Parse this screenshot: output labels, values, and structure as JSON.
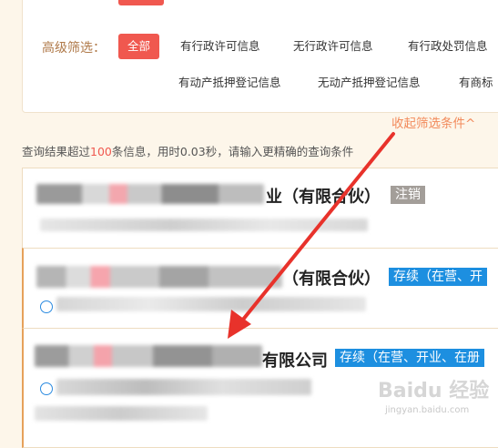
{
  "filter": {
    "label": "高级筛选：",
    "options": [
      {
        "label": "全部",
        "active": true
      },
      {
        "label": "有行政许可信息"
      },
      {
        "label": "无行政许可信息"
      },
      {
        "label": "有行政处罚信息"
      },
      {
        "label": "有动产抵押登记信息"
      },
      {
        "label": "无动产抵押登记信息"
      },
      {
        "label": "有商标"
      }
    ],
    "collapse_label": "收起筛选条件^"
  },
  "summary": {
    "prefix": "查询结果超过",
    "count": "100",
    "suffix": "条信息，用时0.03秒，请输入更精确的查询条件"
  },
  "results": [
    {
      "name_tail": "业（有限合伙）",
      "status": "注销",
      "status_color": "#a39e99"
    },
    {
      "name_tail": "（有限合伙）",
      "status": "存续（在营、开",
      "status_color": "#1d8fe0"
    },
    {
      "name_tail": "有限公司",
      "status": "存续（在营、开业、在册",
      "status_color": "#1d8fe0"
    }
  ],
  "watermark": {
    "logo": "Baidu 经验",
    "url": "jingyan.baidu.com"
  },
  "colors": {
    "accent": "#f0584f",
    "link": "#f28a5b",
    "arrow": "#e8322b"
  }
}
